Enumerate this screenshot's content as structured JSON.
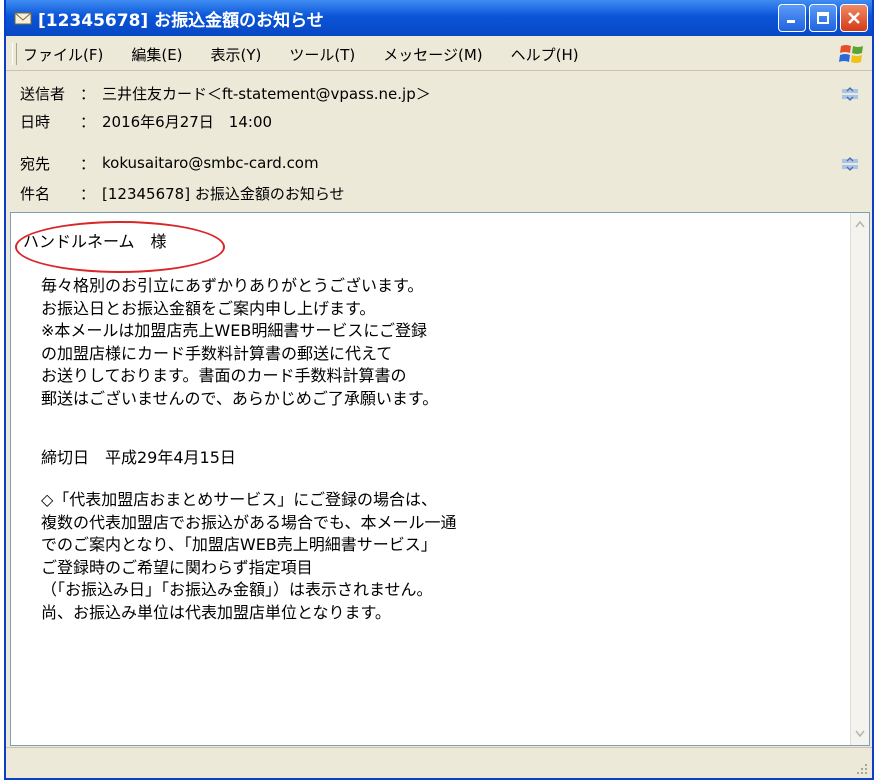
{
  "window": {
    "title": "[12345678] お振込金額のお知らせ"
  },
  "menu": [
    "ファイル(F)",
    "編集(E)",
    "表示(Y)",
    "ツール(T)",
    "メッセージ(M)",
    "ヘルプ(H)"
  ],
  "header": {
    "from_label": "送信者",
    "from_value": "三井住友カード＜ft-statement@vpass.ne.jp＞",
    "date_label": "日時",
    "date_value": "2016年6月27日　14:00",
    "to_label": "宛先",
    "to_value": "kokusaitaro@smbc-card.com",
    "subject_label": "件名",
    "subject_value": "[12345678] お振込金額のお知らせ",
    "separator": "："
  },
  "body": {
    "greeting": "ハンドルネーム　様",
    "paragraph1": [
      "毎々格別のお引立にあずかりありがとうございます。",
      "お振込日とお振込金額をご案内申し上げます。",
      "※本メールは加盟店売上WEB明細書サービスにご登録",
      "の加盟店様にカード手数料計算書の郵送に代えて",
      "お送りしております。書面のカード手数料計算書の",
      "郵送はございませんので、あらかじめご了承願います。"
    ],
    "deadline": "締切日　平成29年4月15日",
    "paragraph2": [
      "◇「代表加盟店おまとめサービス」にご登録の場合は、",
      "複数の代表加盟店でお振込がある場合でも、本メール一通",
      "でのご案内となり、「加盟店WEB売上明細書サービス」",
      "ご登録時のご希望に関わらず指定項目",
      "（「お振込み日」「お振込み金額」）は表示されません。",
      "尚、お振込み単位は代表加盟店単位となります。"
    ]
  },
  "colors": {
    "titlebar": "#0a55d8",
    "annotation_circle": "#d9262a"
  }
}
